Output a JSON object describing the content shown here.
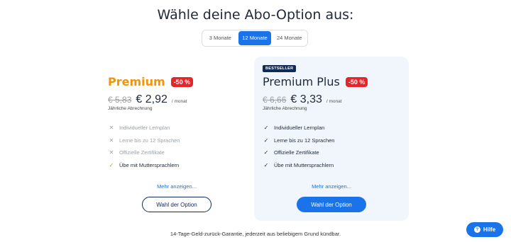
{
  "title": "Wähle deine Abo-Option aus:",
  "tabs": [
    {
      "label": "3 Monate",
      "active": false
    },
    {
      "label": "12 Monate",
      "active": true
    },
    {
      "label": "24 Monate",
      "active": false
    }
  ],
  "plans": [
    {
      "name": "Premium",
      "discount": "-50 %",
      "old_price": "€ 5,83",
      "new_price": "€ 2,92",
      "per": "/ monat",
      "billing": "Jährliche Abrechnung",
      "features": [
        {
          "label": "Individueller Lernplan",
          "included": false
        },
        {
          "label": "Lerne bis zu 12 Sprachen",
          "included": false
        },
        {
          "label": "Offizielle Zertifikate",
          "included": false
        },
        {
          "label": "Übe mit Muttersprachlern",
          "included": true
        }
      ],
      "more": "Mehr anzeigen...",
      "cta": "Wahl der Option"
    },
    {
      "badge": "BESTSELLER",
      "name": "Premium Plus",
      "discount": "-50 %",
      "old_price": "€ 6,66",
      "new_price": "€ 3,33",
      "per": "/ monat",
      "billing": "Jährliche Abrechnung",
      "features": [
        {
          "label": "Individueller Lernplan",
          "included": true
        },
        {
          "label": "Lerne bis zu 12 Sprachen",
          "included": true
        },
        {
          "label": "Offizielle Zertifikate",
          "included": true
        },
        {
          "label": "Übe mit Muttersprachlern",
          "included": true
        }
      ],
      "more": "Mehr anzeigen...",
      "cta": "Wahl der Option"
    }
  ],
  "guarantee": "14-Tage-Geld-zurück-Garantie, jederzeit aus beliebigem Grund kündbar.",
  "help": {
    "label": "Hilfe",
    "icon": "question-icon"
  },
  "colors": {
    "accent": "#1a73e8",
    "premium": "#f0950a",
    "discount": "#e5252a",
    "navy": "#0f2a55",
    "highlight_bg": "#f1f6fc"
  },
  "icons": {
    "included": "check-icon",
    "excluded": "cross-icon"
  }
}
